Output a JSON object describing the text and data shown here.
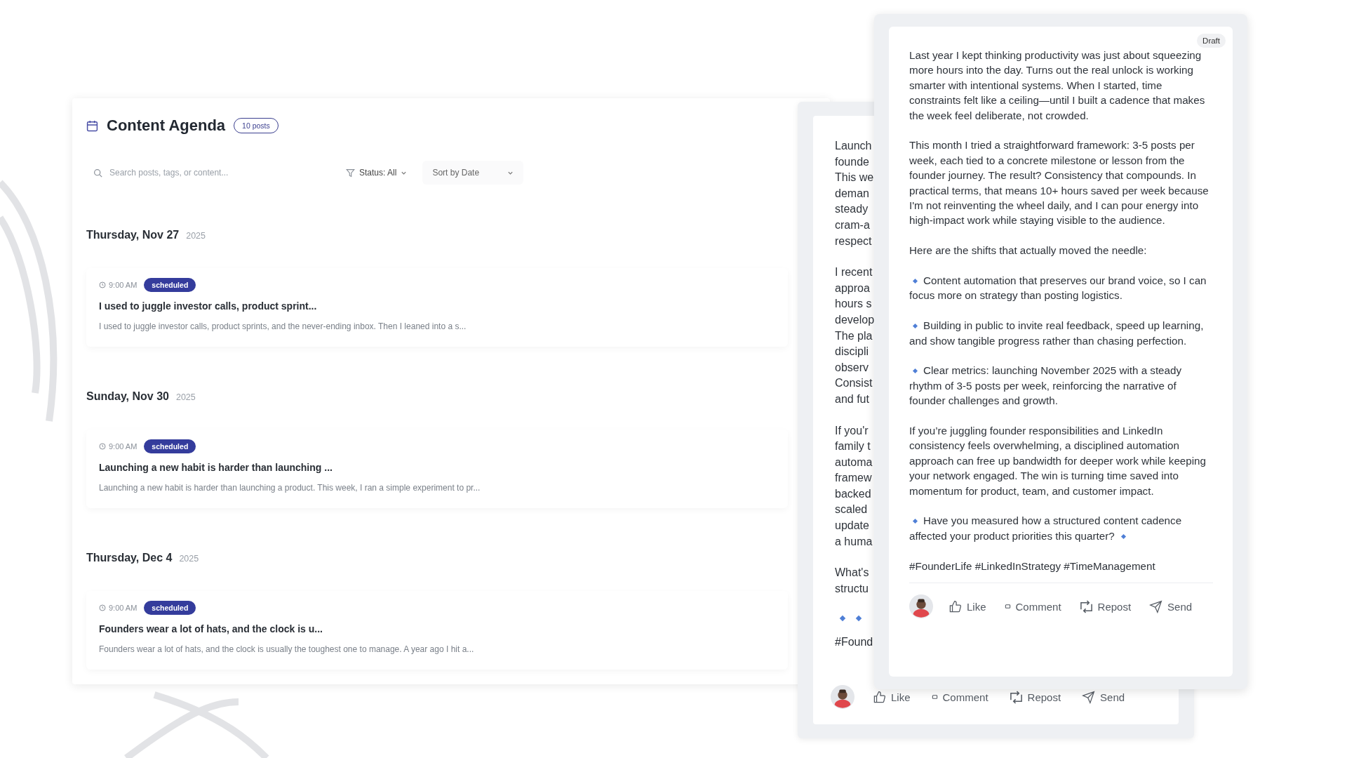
{
  "agenda": {
    "title": "Content Agenda",
    "count": "10 posts",
    "search": {
      "placeholder": "Search posts, tags, or content..."
    },
    "status_filter": "Status: All",
    "sort": "Sort by Date",
    "days": [
      {
        "date": "Thursday, Nov 27",
        "year": "2025",
        "posts": [
          {
            "time": "9:00 AM",
            "status": "scheduled",
            "title": "I used to juggle investor calls, product sprint...",
            "excerpt": "I used to juggle investor calls, product sprints, and the never-ending inbox. Then I leaned into a s..."
          }
        ]
      },
      {
        "date": "Sunday, Nov 30",
        "year": "2025",
        "posts": [
          {
            "time": "9:00 AM",
            "status": "scheduled",
            "title": "Launching a new habit is harder than launching ...",
            "excerpt": "Launching a new habit is harder than launching a product. This week, I ran a simple experiment to pr..."
          }
        ]
      },
      {
        "date": "Thursday, Dec 4",
        "year": "2025",
        "posts": [
          {
            "time": "9:00 AM",
            "status": "scheduled",
            "title": "Founders wear a lot of hats, and the clock is u...",
            "excerpt": "Founders wear a lot of hats, and the clock is usually the toughest one to manage. A year ago I hit a..."
          }
        ]
      }
    ]
  },
  "back_preview": {
    "paragraphs": [
      [
        "Launch",
        "founde",
        "This we",
        "deman",
        "steady",
        "cram-a",
        "respect"
      ],
      [
        "I recent",
        "approa",
        "hours s",
        "develop",
        "The pla",
        "discipli",
        "observ",
        "Consist",
        "and fut"
      ],
      [
        "If you'r",
        "family t",
        "automa",
        "framew",
        "backed",
        "scaled",
        "update",
        "a huma"
      ],
      [
        "What's",
        "structu"
      ]
    ],
    "hashtags": "#Found",
    "actions": [
      {
        "kind": "like",
        "label": "Like"
      },
      {
        "kind": "comment",
        "label": "Comment"
      },
      {
        "kind": "repost",
        "label": "Repost"
      },
      {
        "kind": "send",
        "label": "Send"
      }
    ]
  },
  "front_preview": {
    "badge": "Draft",
    "blocks": [
      {
        "kind": "paragraph",
        "text": "Last year I kept thinking productivity was just about squeezing more hours into the day. Turns out the real unlock is working smarter with intentional systems. When I started, time constraints felt like a ceiling—until I built a cadence that makes the week feel deliberate, not crowded."
      },
      {
        "kind": "paragraph",
        "text": "This month I tried a straightforward framework: 3-5 posts per week, each tied to a concrete milestone or lesson from the founder journey. The result? Consistency that compounds. In practical terms, that means 10+ hours saved per week because I'm not reinventing the wheel daily, and I can pour energy into high-impact work while staying visible to the audience."
      },
      {
        "kind": "paragraph",
        "text": "Here are the shifts that actually moved the needle:"
      },
      {
        "kind": "bullet",
        "end_mark": false,
        "text": "Content automation that preserves our brand voice, so I can focus more on strategy than posting logistics."
      },
      {
        "kind": "bullet",
        "end_mark": false,
        "text": "Building in public to invite real feedback, speed up learning, and show tangible progress rather than chasing perfection."
      },
      {
        "kind": "bullet",
        "end_mark": false,
        "text": "Clear metrics: launching November 2025 with a steady rhythm of 3-5 posts per week, reinforcing the narrative of founder challenges and growth."
      },
      {
        "kind": "paragraph",
        "text": "If you’re juggling founder responsibilities and LinkedIn consistency feels overwhelming, a disciplined automation approach can free up bandwidth for deeper work while keeping your network engaged. The win is turning time saved into momentum for product, team, and customer impact."
      },
      {
        "kind": "bullet",
        "end_mark": true,
        "text": "Have you measured how a structured content cadence affected your product priorities this quarter?"
      },
      {
        "kind": "paragraph",
        "text": "#FounderLife #LinkedInStrategy #TimeManagement"
      }
    ],
    "actions": [
      {
        "kind": "like",
        "label": "Like"
      },
      {
        "kind": "comment",
        "label": "Comment"
      },
      {
        "kind": "repost",
        "label": "Repost"
      },
      {
        "kind": "send",
        "label": "Send"
      }
    ]
  }
}
